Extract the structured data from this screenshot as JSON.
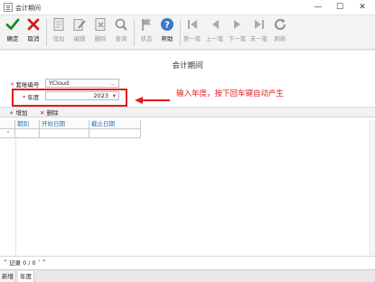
{
  "window": {
    "title": "会计期间",
    "minimize": "—",
    "maximize": "☐",
    "close": "✕"
  },
  "toolbar": [
    {
      "key": "confirm",
      "label": "确定",
      "icon": "checkmark-icon",
      "enabled": true
    },
    {
      "key": "cancel",
      "label": "取消",
      "icon": "x-icon",
      "enabled": true
    },
    {
      "key": "add",
      "label": "增加",
      "icon": "add-document-icon",
      "enabled": false
    },
    {
      "key": "edit",
      "label": "编辑",
      "icon": "edit-icon",
      "enabled": false
    },
    {
      "key": "delete",
      "label": "删除",
      "icon": "delete-icon",
      "enabled": false
    },
    {
      "key": "query",
      "label": "查询",
      "icon": "search-icon",
      "enabled": false
    },
    {
      "key": "status",
      "label": "状态",
      "icon": "flag-icon",
      "enabled": false
    },
    {
      "key": "help",
      "label": "帮助",
      "icon": "help-icon",
      "enabled": true
    },
    {
      "key": "first",
      "label": "第一笔",
      "icon": "first-record-icon",
      "enabled": false
    },
    {
      "key": "prev",
      "label": "上一笔",
      "icon": "previous-icon",
      "enabled": false
    },
    {
      "key": "next",
      "label": "下一笔",
      "icon": "next-icon",
      "enabled": false
    },
    {
      "key": "last",
      "label": "末一笔",
      "icon": "last-record-icon",
      "enabled": false
    },
    {
      "key": "refresh",
      "label": "刷新",
      "icon": "refresh-icon",
      "enabled": false
    }
  ],
  "form": {
    "title": "会计期间",
    "account_label": "套账编号",
    "account_value": "YCloud",
    "account_btn": "…",
    "year_label": "年度",
    "year_value": "2023",
    "year_dropdown": "▾",
    "required_mark": "*"
  },
  "annotation": {
    "text": "输入年度，按下回车键自动产生",
    "color": "#e21a1a"
  },
  "grid_toolbar": {
    "add": "增加",
    "delete": "删除"
  },
  "grid": {
    "columns": [
      "期别",
      "开始日期",
      "截止日期"
    ],
    "new_row_marker": "*"
  },
  "footer": {
    "record_info": "记录 0 / 0"
  },
  "tabs": [
    {
      "label": "新增"
    },
    {
      "label": "年度"
    }
  ],
  "colors": {
    "accent": "#2e6fb8",
    "highlight": "#e21a1a",
    "confirm": "#1a8a2a",
    "cancel": "#d02020"
  }
}
